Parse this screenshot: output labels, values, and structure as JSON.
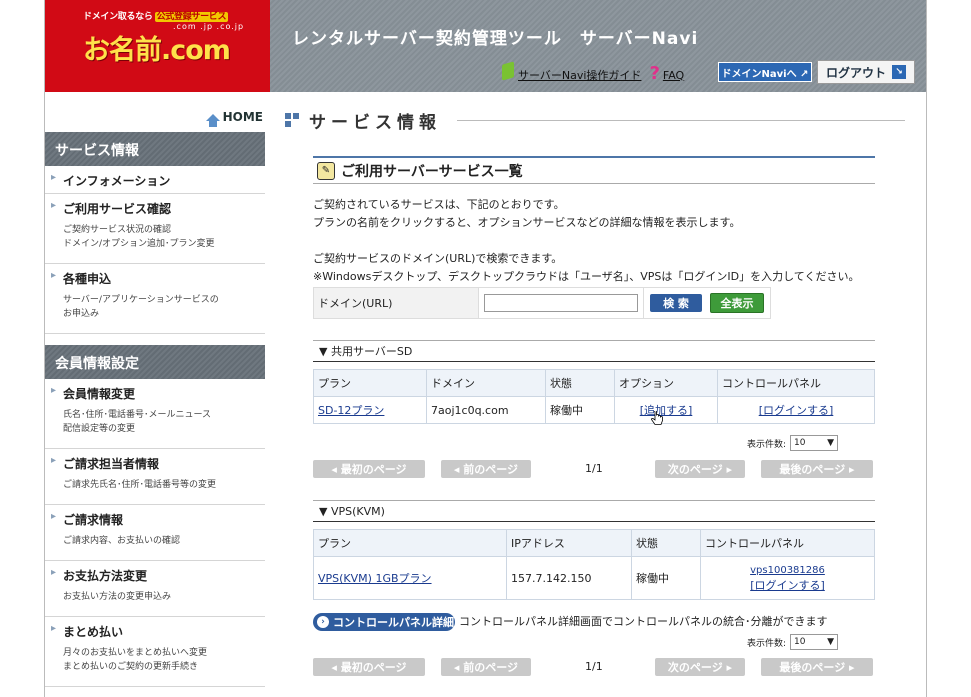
{
  "header": {
    "logo_tagline": "ドメイン取るなら",
    "logo_badge": "公式登録サービス",
    "logo_tlds": ".com .jp .co.jp",
    "logo_main": "お名前.com",
    "title": "レンタルサーバー契約管理ツール　サーバーNavi",
    "guide_link": "サーバーNavi操作ガイド",
    "faq_link": "FAQ",
    "domain_navi_button": "ドメインNaviへ ↗",
    "logout_button": "ログアウト",
    "logout_arrow": "↘"
  },
  "sidebar": {
    "home_label": "HOME",
    "sections": [
      {
        "title": "サービス情報",
        "items": [
          {
            "label": "インフォメーション",
            "desc": ""
          },
          {
            "label": "ご利用サービス確認",
            "desc": "ご契約サービス状況の確認\nドメイン/オプション追加･プラン変更"
          },
          {
            "label": "各種申込",
            "desc": "サーバー/アプリケーションサービスの\nお申込み"
          }
        ]
      },
      {
        "title": "会員情報設定",
        "items": [
          {
            "label": "会員情報変更",
            "desc": "氏名･住所･電話番号･メールニュース\n配信設定等の変更"
          },
          {
            "label": "ご請求担当者情報",
            "desc": "ご請求先氏名･住所･電話番号等の変更"
          },
          {
            "label": "ご請求情報",
            "desc": "ご請求内容、お支払いの確認"
          },
          {
            "label": "お支払方法変更",
            "desc": "お支払い方法の変更申込み"
          },
          {
            "label": "まとめ払い",
            "desc": "月々のお支払いをまとめ払いへ変更\nまとめ払いのご契約の更新手続き"
          }
        ]
      }
    ]
  },
  "main": {
    "page_title": "サービス情報",
    "box_title": "ご利用サーバーサービス一覧",
    "intro_lines": [
      "ご契約されているサービスは、下記のとおりです。",
      "プランの名前をクリックすると、オプションサービスなどの詳細な情報を表示します。",
      "",
      "ご契約サービスのドメイン(URL)で検索できます。",
      "※Windowsデスクトップ、デスクトップクラウドは「ユーザ名」、VPSは「ログインID」を入力してください。"
    ],
    "search_label": "ドメイン(URL)",
    "search_value": "",
    "search_button": "検 索",
    "show_all_button": "全表示",
    "shared": {
      "group_title": "▼ 共用サーバーSD",
      "headers": [
        "プラン",
        "ドメイン",
        "状態",
        "オプション",
        "コントロールパネル"
      ],
      "rows": [
        {
          "plan": "SD-12プラン",
          "domain": "7aoj1c0q.com",
          "status": "稼働中",
          "option": "[追加する]",
          "panel": "[ログインする]"
        }
      ],
      "perpage_label": "表示件数:",
      "perpage_value": "10",
      "first_page": "◂ 最初のページ",
      "prev_page": "◂ 前のページ",
      "page_num": "1/1",
      "next_page": "次のページ ▸",
      "last_page": "最後のページ ▸"
    },
    "vps": {
      "group_title": "▼ VPS(KVM)",
      "headers": [
        "プラン",
        "IPアドレス",
        "状態",
        "コントロールパネル"
      ],
      "rows": [
        {
          "plan": "VPS(KVM) 1GBプラン",
          "ip": "157.7.142.150",
          "status": "稼働中",
          "panel_id": "vps100381286",
          "panel_login": "[ログインする]"
        }
      ],
      "cp_detail_button": "コントロールパネル詳細",
      "cp_note": "コントロールパネル詳細画面でコントロールパネルの統合･分離ができます",
      "perpage_label": "表示件数:",
      "perpage_value": "10",
      "first_page": "◂ 最初のページ",
      "prev_page": "◂ 前のページ",
      "page_num": "1/1",
      "next_page": "次のページ ▸",
      "last_page": "最後のページ ▸"
    }
  },
  "colors": {
    "brand_red": "#d10a15",
    "accent_blue": "#2f5c9e",
    "green": "#3e9b3a"
  }
}
